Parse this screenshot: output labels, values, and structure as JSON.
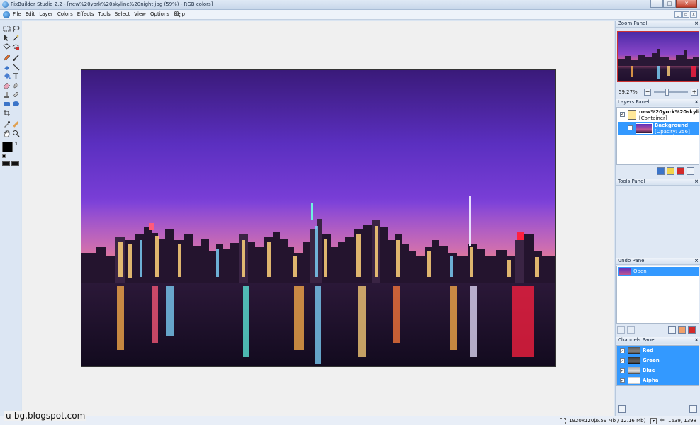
{
  "window": {
    "title": "PixBuilder Studio 2.2 - [new%20york%20skyline%20night.jpg (59%) - RGB colors]",
    "minimize": "–",
    "maximize": "□",
    "close": "✕"
  },
  "menubar": {
    "items": [
      "File",
      "Edit",
      "Layer",
      "Colors",
      "Effects",
      "Tools",
      "Select",
      "View",
      "Options",
      "Help"
    ]
  },
  "zoom_panel": {
    "title": "Zoom Panel",
    "value": "59.27%",
    "minus": "−",
    "plus": "+"
  },
  "layers_panel": {
    "title": "Layers Panel",
    "layers": [
      {
        "name": "new%20york%20skylin...",
        "sub": "[Container]"
      },
      {
        "name": "Background",
        "sub": "[Opacity: 256]"
      }
    ]
  },
  "tools_panel": {
    "title": "Tools Panel"
  },
  "undo_panel": {
    "title": "Undo Panel",
    "items": [
      "Open"
    ]
  },
  "channels_panel": {
    "title": "Channels Panel",
    "channels": [
      "Red",
      "Green",
      "Blue",
      "Alpha"
    ]
  },
  "statusbar": {
    "image_size": "1920x1200",
    "memory": "(6.59 Mb / 12.16 Mb)",
    "coords": "1639, 1398"
  },
  "watermark": "u-bg.blogspot.com",
  "colors": {
    "accent": "#3399ff",
    "selection": "#3399ff",
    "canvas_bg": "#f0f0f0"
  }
}
